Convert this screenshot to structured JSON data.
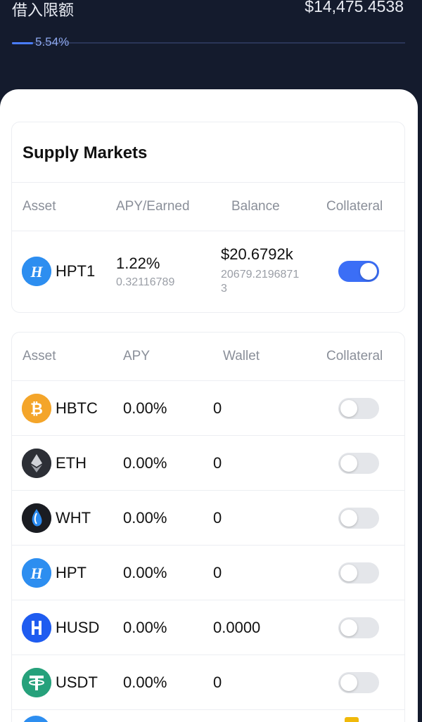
{
  "limit": {
    "label": "借入限额",
    "value": "$14,475.4538",
    "percent_text": "5.54%",
    "progress_fraction": 0.0554
  },
  "supply_markets": {
    "title": "Supply Markets",
    "headers": [
      "Asset",
      "APY/Earned",
      "Balance",
      "Collateral"
    ],
    "rows": [
      {
        "symbol": "HPT1",
        "icon": "hpt-logo-icon",
        "apy": "1.22%",
        "earned": "0.32116789",
        "balance": "$20.6792k",
        "balance_raw": "20679.2196871\n3",
        "collateral": true
      }
    ]
  },
  "all_markets": {
    "headers": [
      "Asset",
      "APY",
      "Wallet",
      "Collateral"
    ],
    "rows": [
      {
        "symbol": "HBTC",
        "icon": "hbtc-logo-icon",
        "apy": "0.00%",
        "wallet": "0",
        "collateral": false,
        "color": "#f4a52a"
      },
      {
        "symbol": "ETH",
        "icon": "eth-logo-icon",
        "apy": "0.00%",
        "wallet": "0",
        "collateral": false,
        "color": "#2c2f36"
      },
      {
        "symbol": "WHT",
        "icon": "wht-logo-icon",
        "apy": "0.00%",
        "wallet": "0",
        "collateral": false,
        "color": "#1a1c22"
      },
      {
        "symbol": "HPT",
        "icon": "hpt-logo-icon",
        "apy": "0.00%",
        "wallet": "0",
        "collateral": false,
        "color": "#2d8ef0"
      },
      {
        "symbol": "HUSD",
        "icon": "husd-logo-icon",
        "apy": "0.00%",
        "wallet": "0.0000",
        "collateral": false,
        "color": "#1f5cf0"
      },
      {
        "symbol": "USDT",
        "icon": "usdt-logo-icon",
        "apy": "0.00%",
        "wallet": "0",
        "collateral": false,
        "color": "#26a17b"
      }
    ]
  },
  "colors": {
    "background": "#141b2d",
    "accent": "#3b6ef6",
    "progress": "#4a7dff"
  }
}
